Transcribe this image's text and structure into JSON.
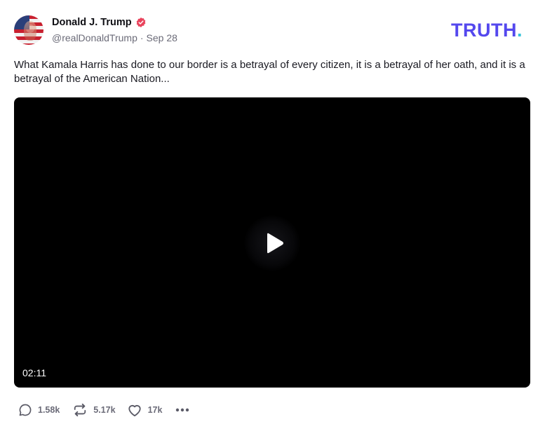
{
  "author": {
    "display_name": "Donald J. Trump",
    "handle": "@realDonaldTrump",
    "separator": "·",
    "date": "Sep 28",
    "verified_icon": "verified-badge-icon",
    "avatar": "avatar-image"
  },
  "brand": {
    "logo_text": "TRUTH",
    "logo_dot": ".",
    "logo_color": "#5448ee",
    "dot_color": "#36c3d8"
  },
  "status": {
    "text": "What Kamala Harris has done to our border is a betrayal of every citizen, it is a betrayal of her oath, and it is a betrayal of the American Nation..."
  },
  "media": {
    "type": "video",
    "duration": "02:11",
    "play_icon": "play-icon"
  },
  "actions": {
    "replies": {
      "icon": "reply-icon",
      "count": "1.58k"
    },
    "reposts": {
      "icon": "repost-icon",
      "count": "5.17k"
    },
    "likes": {
      "icon": "heart-icon",
      "count": "17k"
    },
    "more": {
      "icon": "more-icon"
    }
  },
  "colors": {
    "verified": "#e9435c",
    "muted_text": "#6b6b78",
    "video_bg": "#000000"
  }
}
